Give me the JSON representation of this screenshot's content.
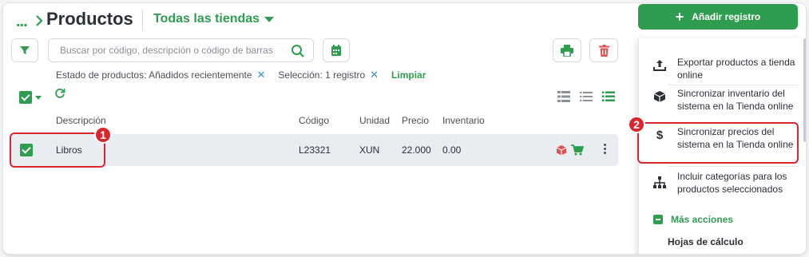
{
  "header": {
    "breadcrumb_dots": "...",
    "title": "Productos",
    "store_select": "Todas las tiendas",
    "add_button": "Añadir registro"
  },
  "toolbar": {
    "search_placeholder": "Buscar por código, descripción o código de barras"
  },
  "filters": {
    "status": "Estado de productos: Añadidos recientemente",
    "selection": "Selección: 1 registro",
    "clear": "Limpiar"
  },
  "table": {
    "columns": [
      "Descripción",
      "Código",
      "Unidad",
      "Precio",
      "Inventario"
    ],
    "rows": [
      {
        "description": "Libros",
        "code": "L23321",
        "unit": "XUN",
        "price": "22.000",
        "inventory": "0.00"
      }
    ]
  },
  "menu": {
    "items": [
      {
        "label": "Exportar productos a tienda online",
        "icon": "upload-icon"
      },
      {
        "label": "Sincronizar inventario del sistema en la Tienda online",
        "icon": "box-icon"
      },
      {
        "label": "Sincronizar precios del sistema en la Tienda online",
        "icon": "dollar-icon"
      },
      {
        "label": "Incluir categorías para los productos seleccionados",
        "icon": "hierarchy-icon"
      }
    ],
    "more_actions": "Más acciones",
    "spreadsheets": "Hojas de cálculo"
  },
  "annotations": {
    "badge_1": "1",
    "badge_2": "2"
  },
  "colors": {
    "accent": "#2e9d4f",
    "danger": "#d9262c",
    "link": "#3b8fd6"
  }
}
